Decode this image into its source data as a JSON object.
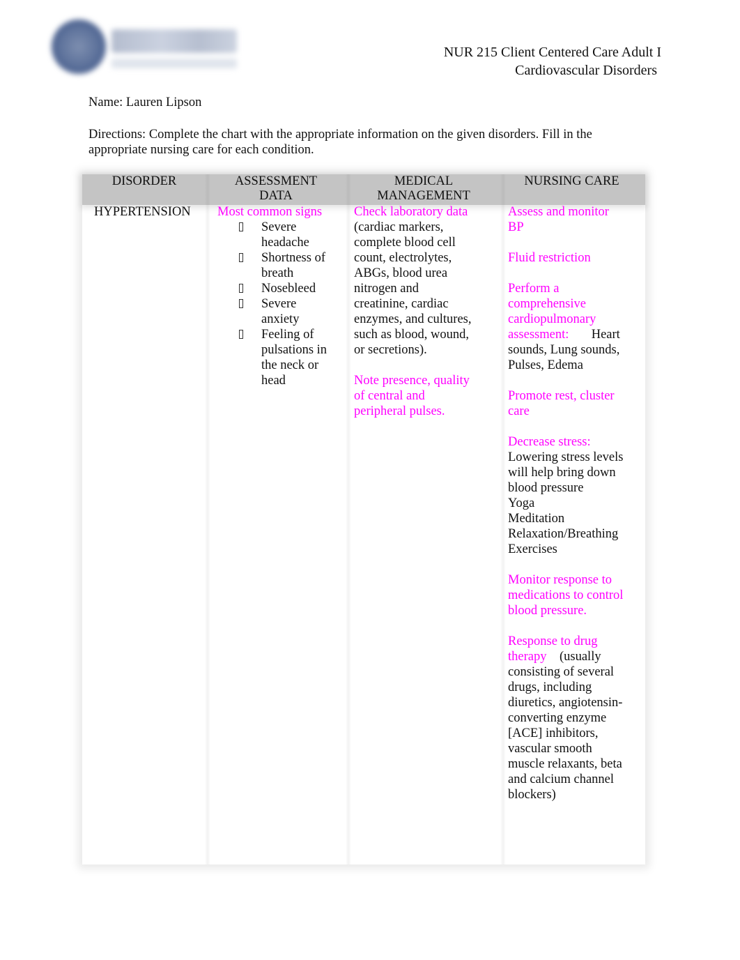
{
  "header": {
    "logo_name": "college-logo",
    "course_title": "NUR 215 Client Centered Care Adult I",
    "topic": "Cardiovascular Disorders"
  },
  "student": {
    "name_line": "Name: Lauren Lipson"
  },
  "directions": "Directions: Complete the chart with the appropriate information on the given disorders. Fill in the appropriate nursing care for each condition.",
  "table": {
    "columns": [
      "DISORDER",
      "ASSESSMENT DATA",
      "MEDICAL MANAGEMENT",
      "NURSING CARE"
    ],
    "column_lines": {
      "assessment": [
        "ASSESSMENT",
        "DATA"
      ],
      "medical": [
        "MEDICAL",
        "MANAGEMENT"
      ]
    },
    "rows": [
      {
        "disorder": "HYPERTENSION",
        "assessment": {
          "heading": "Most common signs",
          "signs": [
            "Severe headache",
            "Shortness of breath",
            "Nosebleed",
            "Severe anxiety",
            "Feeling of pulsations in the neck or head"
          ]
        },
        "medical": {
          "lab_heading": "Check laboratory data",
          "lab_detail": "(cardiac markers, complete blood cell count, electrolytes, ABGs, blood urea nitrogen and creatinine, cardiac enzymes, and cultures, such as blood, wound, or secretions).",
          "pulses": "Note presence, quality of central and peripheral pulses."
        },
        "nursing": {
          "bp": "Assess and monitor BP",
          "fluid": "Fluid restriction",
          "assessment_heading": "Perform a comprehensive cardiopulmonary assessment:",
          "assessment_detail": "Heart sounds, Lung sounds, Pulses, Edema",
          "rest": "Promote rest, cluster care",
          "stress_heading": "Decrease stress:",
          "stress_detail": "Lowering stress levels will help bring down blood pressure",
          "stress_items": [
            "Yoga",
            "Meditation",
            "Relaxation/Breathing Exercises"
          ],
          "meds": "Monitor response to medications to control blood pressure.",
          "drug_heading": "Response to drug therapy",
          "drug_detail": "(usually consisting of several drugs, including diuretics, angiotensin-converting enzyme [ACE] inhibitors, vascular smooth muscle relaxants, beta and calcium channel blockers)"
        }
      }
    ]
  },
  "colors": {
    "answer_text": "#ff00ff",
    "header_fill": "#c4c4c4",
    "body_text": "#111111"
  }
}
